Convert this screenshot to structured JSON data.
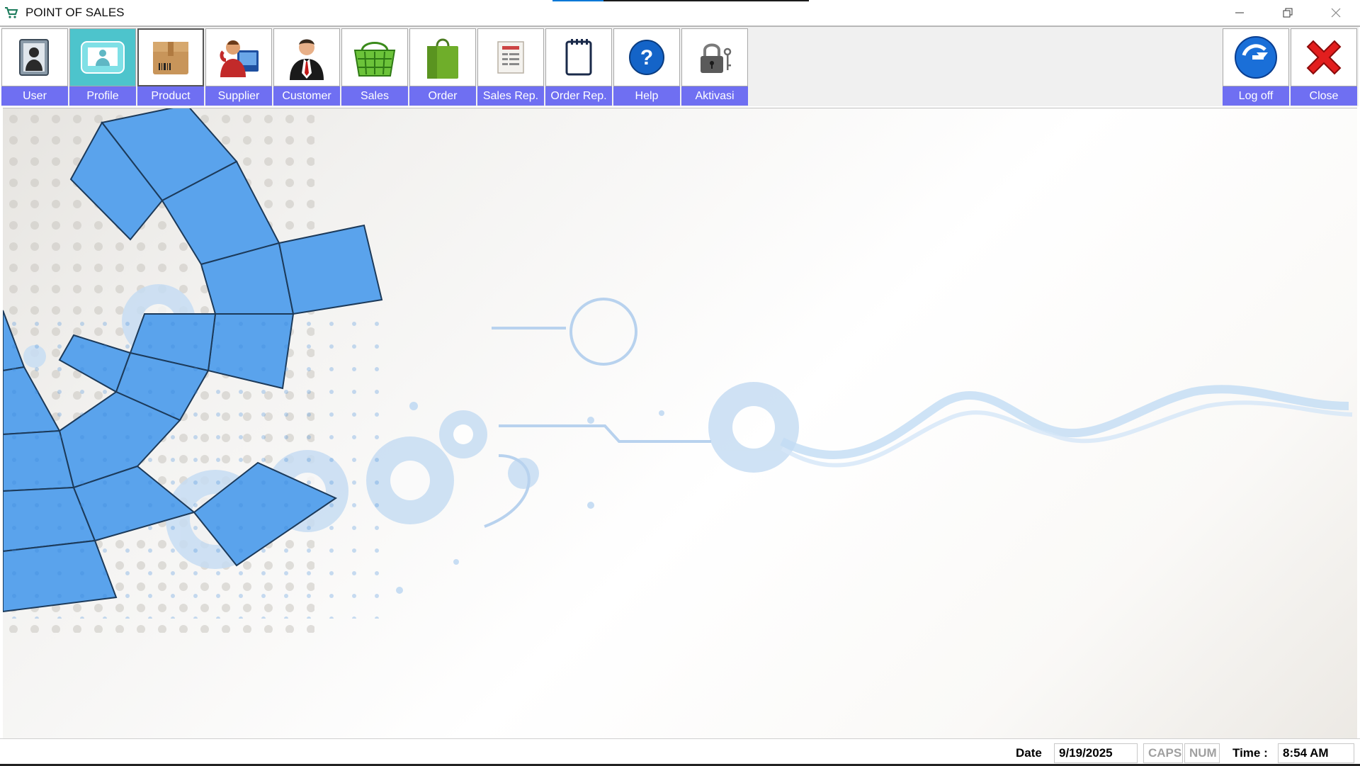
{
  "window": {
    "title": "POINT OF SALES",
    "icon": "shopping-cart-icon",
    "controls": [
      "minimize-icon",
      "restore-icon",
      "close-icon"
    ],
    "loading_progress": 0.2
  },
  "toolbar": {
    "left": [
      {
        "key": "user",
        "label": "User",
        "icon": "user-id-card-icon"
      },
      {
        "key": "profile",
        "label": "Profile",
        "icon": "profile-icon"
      },
      {
        "key": "product",
        "label": "Product",
        "icon": "product-box-icon"
      },
      {
        "key": "supplier",
        "label": "Supplier",
        "icon": "supplier-phone-icon"
      },
      {
        "key": "customer",
        "label": "Customer",
        "icon": "customer-businessman-icon"
      },
      {
        "key": "sales",
        "label": "Sales",
        "icon": "shopping-basket-icon"
      },
      {
        "key": "order",
        "label": "Order",
        "icon": "shopping-bag-icon"
      },
      {
        "key": "sales_rep",
        "label": "Sales Rep.",
        "icon": "report-sheet-icon"
      },
      {
        "key": "order_rep",
        "label": "Order Rep.",
        "icon": "notepad-icon"
      },
      {
        "key": "help",
        "label": "Help",
        "icon": "help-question-icon"
      },
      {
        "key": "aktivasi",
        "label": "Aktivasi",
        "icon": "lock-key-icon"
      }
    ],
    "right": [
      {
        "key": "logoff",
        "label": "Log off",
        "icon": "logoff-arrow-icon"
      },
      {
        "key": "close",
        "label": "Close",
        "icon": "red-x-icon"
      }
    ],
    "label_color": "#6f6ff2"
  },
  "status": {
    "date_label": "Date",
    "date_value": "9/19/2025",
    "caps": "CAPS",
    "num": "NUM",
    "time_label": "Time :",
    "time_value": "8:54 AM"
  },
  "background": {
    "accent": "#5aa3ec"
  }
}
